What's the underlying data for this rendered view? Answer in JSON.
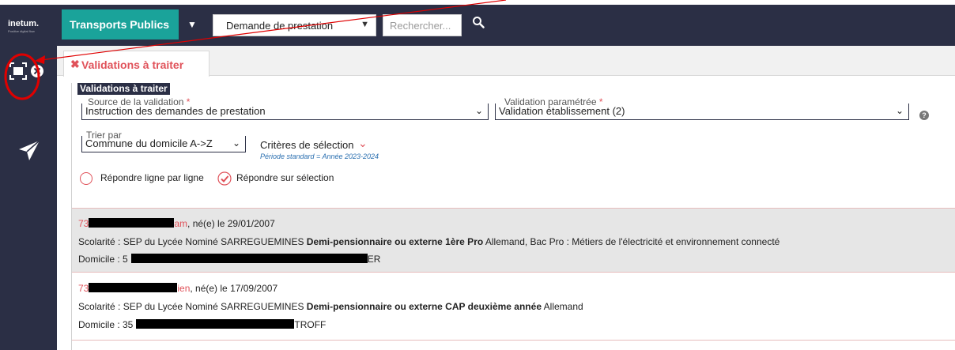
{
  "topbar": {
    "logo_text": "inetum.",
    "logo_sub": "Positive digital flow",
    "module_label": "Transports Publics",
    "select_value": "Demande de prestation",
    "search_placeholder": "Rechercher..."
  },
  "tab": {
    "label": "Validations à traiter"
  },
  "form": {
    "legend": "Validations à traiter",
    "source_label": "Source de la validation",
    "source_value": "Instruction des demandes de prestation",
    "validation_label": "Validation paramétrée",
    "validation_value": "Validation établissement (2)",
    "required_mark": "*",
    "trier_label": "Trier par",
    "trier_value": "Commune du domicile A->Z",
    "criteres_label": "Critères de sélection",
    "periode_text": "Période standard = Année 2023-2024",
    "radio_line": "Répondre ligne par ligne",
    "radio_selection": "Répondre sur sélection"
  },
  "results": [
    {
      "id_prefix": "73",
      "name_tail": "am",
      "dob": ", né(e) le 29/01/2007",
      "scolarite_prefix": "Scolarité : SEP du Lycée Nominé SARREGUEMINES ",
      "scolarite_bold": "Demi-pensionnaire ou externe 1ère Pro",
      "scolarite_suffix": " Allemand, Bac Pro : Métiers de l'électricité et environnement connecté",
      "domicile_prefix": "Domicile : 5",
      "domicile_suffix": "ER"
    },
    {
      "id_prefix": "73",
      "name_tail": "ien",
      "dob": ", né(e) le 17/09/2007",
      "scolarite_prefix": "Scolarité : SEP du Lycée Nominé SARREGUEMINES ",
      "scolarite_bold": "Demi-pensionnaire ou externe CAP deuxième année",
      "scolarite_suffix": " Allemand",
      "domicile_prefix": "Domicile : 35",
      "domicile_suffix": "TROFF"
    }
  ],
  "colors": {
    "navy": "#2b2f45",
    "teal": "#1aa39a",
    "accent_red": "#e0525a",
    "annotation_red": "#e00000"
  },
  "icons": [
    "fullscreen-icon",
    "close-icon",
    "paper-plane-icon",
    "search-icon",
    "chevron-down-icon",
    "help-icon"
  ]
}
